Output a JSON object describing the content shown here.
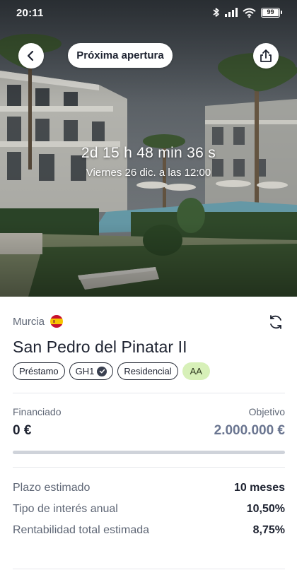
{
  "status_bar": {
    "time": "20:11",
    "battery": "99"
  },
  "header": {
    "badge_label": "Próxima apertura"
  },
  "hero": {
    "countdown": "2d 15 h 48 min 36 s",
    "opening_date": "Viernes 26 dic. a las 12:00"
  },
  "project": {
    "location": "Murcia",
    "title": "San Pedro del Pinatar II",
    "tags": [
      "Préstamo",
      "GH1",
      "Residencial",
      "AA"
    ]
  },
  "funding": {
    "financed_label": "Financiado",
    "financed_value": "0 €",
    "target_label": "Objetivo",
    "target_value": "2.000.000 €",
    "progress": 0
  },
  "details": [
    {
      "label": "Plazo estimado",
      "value": "10 meses"
    },
    {
      "label": "Tipo de interés anual",
      "value": "10,50%"
    },
    {
      "label": "Rentabilidad total estimada",
      "value": "8,75%"
    }
  ],
  "colors": {
    "accent": "#6a7590",
    "grade_bg": "#d7f0b8",
    "text": "#1d2230",
    "muted": "#5f6776"
  },
  "icons": [
    "back-arrow-icon",
    "share-icon",
    "refresh-icon",
    "verified-check-icon",
    "spain-flag-icon",
    "bluetooth-icon",
    "signal-icon",
    "wifi-icon",
    "battery-icon"
  ]
}
